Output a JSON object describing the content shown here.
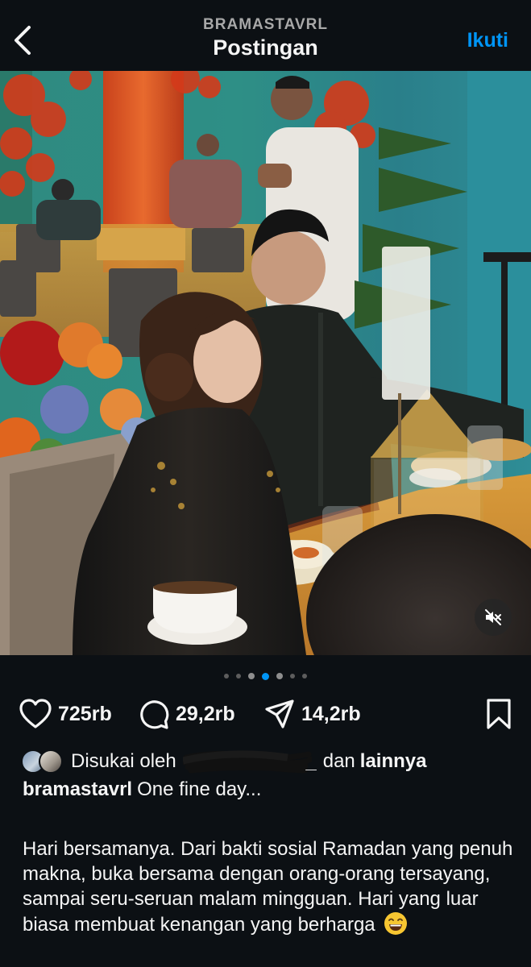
{
  "header": {
    "username": "BRAMASTAVRL",
    "title": "Postingan",
    "follow_label": "Ikuti"
  },
  "carousel": {
    "total_slides": 7,
    "active_index": 3
  },
  "actions": {
    "likes_count": "725rb",
    "comments_count": "29,2rb",
    "shares_count": "14,2rb"
  },
  "liked_by": {
    "prefix": "Disukai oleh",
    "visible_name_suffix": "_",
    "connector": "dan",
    "others": "lainnya"
  },
  "caption": {
    "username": "bramastavrl",
    "headline": "One fine day...",
    "body": "Hari bersamanya. Dari bakti sosial Ramadan yang penuh makna, buka bersama dengan orang-orang tersayang, sampai seru-seruan malam mingguan. Hari yang luar biasa membuat kenangan yang berharga",
    "emoji": "grinning-face"
  },
  "colors": {
    "background": "#0c1014",
    "accent": "#0095f6",
    "text": "#f5f5f5",
    "muted": "#a8a8a8"
  },
  "icons": {
    "back": "chevron-left-icon",
    "mute": "speaker-muted-icon",
    "like": "heart-icon",
    "comment": "comment-bubble-icon",
    "share": "paper-plane-icon",
    "save": "bookmark-icon"
  }
}
